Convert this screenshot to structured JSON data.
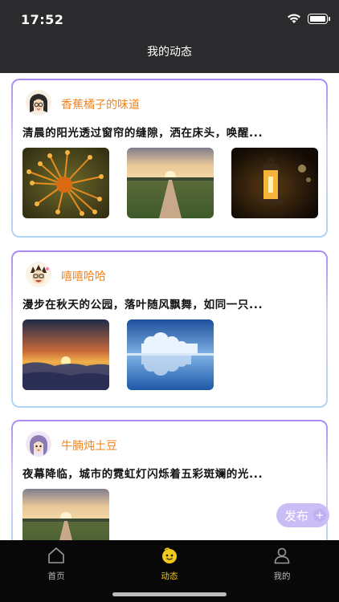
{
  "status_bar": {
    "time": "17:52",
    "icons": [
      "wifi-icon",
      "battery-icon"
    ]
  },
  "nav": {
    "title": "我的动态"
  },
  "posts": [
    {
      "author": "香蕉橘子的味道",
      "text": "清晨的阳光透过窗帘的缝隙，洒在床头，唤醒...",
      "images": [
        "orange-flower-photo",
        "country-road-sunset-photo",
        "lantern-photo"
      ]
    },
    {
      "author": "嘻嘻哈哈",
      "text": "漫步在秋天的公园，落叶随风飘舞，如同一只...",
      "images": [
        "sunrise-over-clouds-photo",
        "frozen-trees-lake-photo"
      ]
    },
    {
      "author": "牛腩炖土豆",
      "text": "夜幕降临，城市的霓虹灯闪烁着五彩斑斓的光...",
      "images": [
        "country-road-sunset-photo"
      ]
    }
  ],
  "publish_button": {
    "label": "发布",
    "icon": "plus-icon"
  },
  "tabs": [
    {
      "label": "首页",
      "icon": "home-icon",
      "active": false
    },
    {
      "label": "动态",
      "icon": "moments-icon",
      "active": true
    },
    {
      "label": "我的",
      "icon": "profile-icon",
      "active": false
    }
  ],
  "colors": {
    "accent": "#f0841f",
    "tab_active": "#f2c91a",
    "nav_bg": "#2b2b2d",
    "tab_bg": "#080808"
  }
}
